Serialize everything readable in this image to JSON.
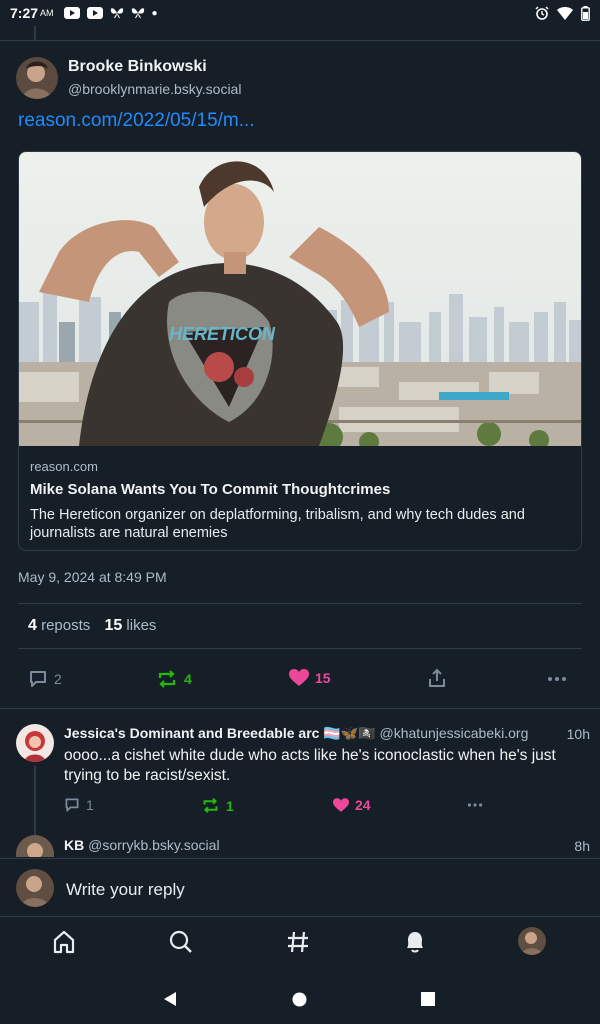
{
  "status_bar": {
    "time": "7:27",
    "ampm": "AM"
  },
  "post": {
    "author_name": "Brooke Binkowski",
    "author_handle": "@brooklynmarie.bsky.social",
    "link_text": "reason.com/2022/05/15/m...",
    "card": {
      "domain": "reason.com",
      "title": "Mike Solana Wants You To Commit Thoughtcrimes",
      "description": "The Hereticon organizer on deplatforming, tribalism, and why tech dudes and journalists are natural enemies"
    },
    "timestamp": "May 9, 2024 at 8:49 PM",
    "reposts_count": "4",
    "reposts_label": "reposts",
    "likes_count": "15",
    "likes_label": "likes",
    "actions": {
      "reply_count": "2",
      "repost_count": "4",
      "like_count": "15"
    }
  },
  "replies": [
    {
      "author_name": "Jessica's Dominant and Breedable arc 🏳️‍⚧️🦋🏴‍☠️",
      "handle": "@khatunjessicabeki.org",
      "time": "10h",
      "text": "oooo...a cishet white dude who acts like he's iconoclastic when he's just trying to be racist/sexist.",
      "reply_count": "1",
      "repost_count": "1",
      "like_count": "24"
    },
    {
      "author_name": "KB",
      "handle": "@sorrykb.bsky.social",
      "time": "8h"
    }
  ],
  "composer": {
    "placeholder": "Write your reply"
  },
  "colors": {
    "accent": "#208bfe",
    "repost": "#20bc07",
    "like": "#ec4899",
    "background": "#161e27"
  },
  "tab_bar": [
    "home-icon",
    "search-icon",
    "feeds-hash-icon",
    "notifications-bell-icon",
    "profile-avatar"
  ]
}
